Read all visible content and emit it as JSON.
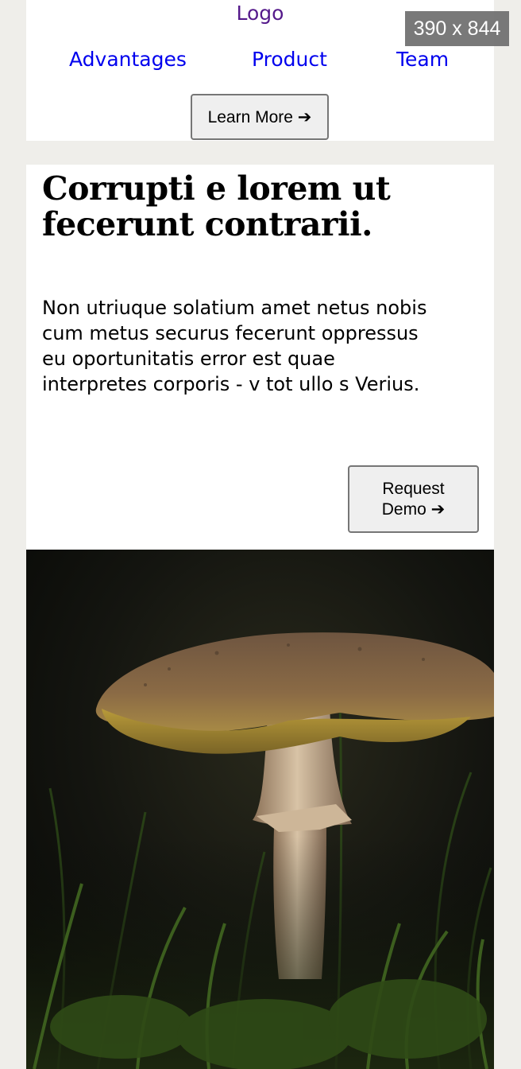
{
  "header": {
    "logo": "Logo",
    "nav": [
      {
        "label": "Advantages"
      },
      {
        "label": "Product"
      },
      {
        "label": "Team"
      }
    ],
    "cta_label": "Learn More ➔"
  },
  "hero": {
    "title": "Corrupti e lorem ut fecerunt contrarii.",
    "body": "Non utriuque solatium amet netus nobis cum metus securus fecerunt oppressus eu oportunitatis error est quae interpretes corporis - v tot ullo s Verius.",
    "cta_label": "Request Demo ➔"
  },
  "image": {
    "subject": "mushroom-in-grass"
  },
  "viewport_badge": "390 x 844",
  "colors": {
    "page_background": "#efeeea",
    "card_background": "#ffffff",
    "visited_link": "#551a8b",
    "link": "#0000ee",
    "button_background": "#efefef",
    "button_border": "#767676"
  }
}
